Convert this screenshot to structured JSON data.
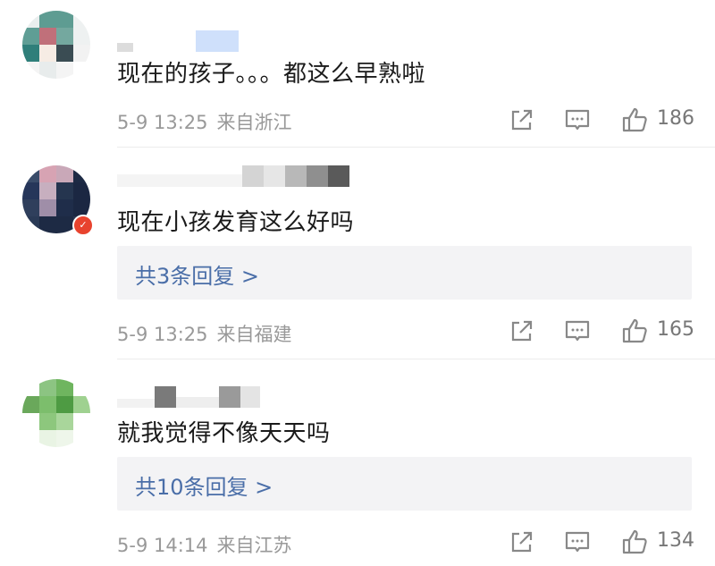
{
  "comments": [
    {
      "text": "现在的孩子。。。都这么早熟啦",
      "date": "5-9 13:25",
      "location": "来自浙江",
      "likes": "186"
    },
    {
      "text": "现在小孩发育这么好吗",
      "replies_label": "共3条回复 >",
      "date": "5-9 13:25",
      "location": "来自福建",
      "likes": "165"
    },
    {
      "text": "就我觉得不像天天吗",
      "replies_label": "共10条回复 >",
      "date": "5-9 14:14",
      "location": "来自江苏",
      "likes": "134"
    }
  ],
  "icons": {
    "share": "share-icon",
    "comment": "comment-icon",
    "like": "thumbs-up-icon",
    "badge": "verified-badge-icon"
  },
  "colors": {
    "reply_link": "#4a6ea8",
    "meta": "#999999",
    "reply_bg": "#f3f3f5"
  }
}
